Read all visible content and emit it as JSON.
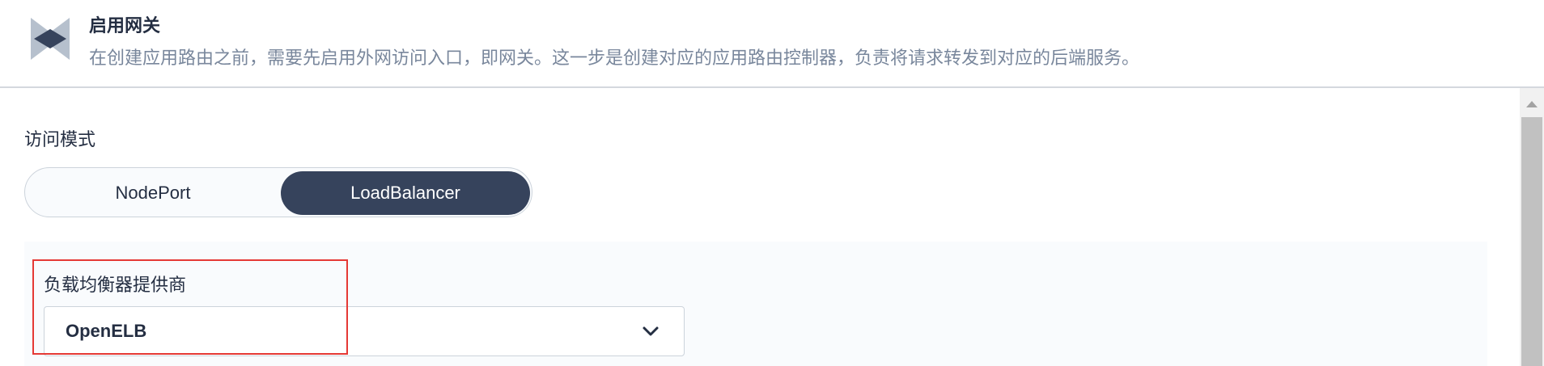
{
  "header": {
    "title": "启用网关",
    "description": "在创建应用路由之前，需要先启用外网访问入口，即网关。这一步是创建对应的应用路由控制器，负责将请求转发到对应的后端服务。",
    "logo_icon": "gateway-logo-icon"
  },
  "access_mode": {
    "label": "访问模式",
    "options": [
      "NodePort",
      "LoadBalancer"
    ],
    "selected": "LoadBalancer"
  },
  "provider": {
    "label": "负载均衡器提供商",
    "value": "OpenELB",
    "dropdown_icon": "chevron-down-icon"
  },
  "colors": {
    "accent": "#36435c",
    "highlight": "#e53935",
    "muted_text": "#79879c"
  }
}
